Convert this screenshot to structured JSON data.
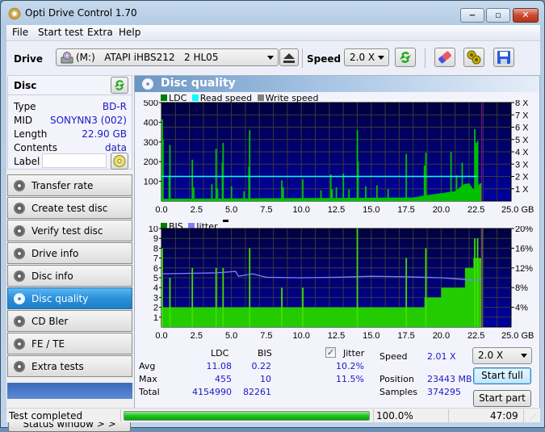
{
  "window": {
    "title": "Opti Drive Control 1.70",
    "controls": {
      "minimize": "‒",
      "maximize": "▫",
      "close": "✕"
    }
  },
  "menu": [
    "File",
    "Start test",
    "Extra",
    "Help"
  ],
  "toolbar": {
    "drive_label": "Drive",
    "drive_value": "(M:)   ATAPI iHBS212   2 HL05",
    "speed_label": "Speed",
    "speed_value": "2.0 X",
    "icons": [
      "eject-icon",
      "refresh-icon",
      "erase-icon",
      "settings-icon",
      "save-icon"
    ]
  },
  "disc": {
    "header": "Disc",
    "rows": [
      {
        "key": "Type",
        "value": "BD-R"
      },
      {
        "key": "MID",
        "value": "SONYNN3 (002)"
      },
      {
        "key": "Length",
        "value": "22.90 GB"
      },
      {
        "key": "Contents",
        "value": "data"
      }
    ],
    "label_key": "Label",
    "label_value": ""
  },
  "nav": [
    {
      "label": "Transfer rate",
      "active": false
    },
    {
      "label": "Create test disc",
      "active": false
    },
    {
      "label": "Verify test disc",
      "active": false
    },
    {
      "label": "Drive info",
      "active": false
    },
    {
      "label": "Disc info",
      "active": false
    },
    {
      "label": "Disc quality",
      "active": true
    },
    {
      "label": "CD Bler",
      "active": false
    },
    {
      "label": "FE / TE",
      "active": false
    },
    {
      "label": "Extra tests",
      "active": false
    }
  ],
  "status_window_button": "Status window > >",
  "panel": {
    "title": "Disc quality",
    "colors": {
      "ldc": "#00c000",
      "read_speed": "#00ffff",
      "write_speed": "#808080",
      "bis": "#00c000",
      "jitter": "#8080ff",
      "plot_bg_top": "#000040",
      "plot_bg_bottom": "#0000a0",
      "grid": "#3a3a3a",
      "marker": "#a000a0"
    }
  },
  "chart_data": [
    {
      "type": "bar",
      "title": "LDC",
      "legend": [
        "LDC",
        "Read speed",
        "Write speed"
      ],
      "legend_position": "top-left",
      "xlabel": "GB",
      "xlim": [
        0,
        25
      ],
      "x_ticks": [
        "0.0",
        "2.5",
        "5.0",
        "7.5",
        "10.0",
        "12.5",
        "15.0",
        "17.5",
        "20.0",
        "22.5",
        "25.0 GB"
      ],
      "y_left_ticks": [
        "100",
        "200",
        "300",
        "400",
        "500"
      ],
      "ylim_left": [
        0,
        500
      ],
      "y_right_ticks": [
        "1 X",
        "2 X",
        "3 X",
        "4 X",
        "5 X",
        "6 X",
        "7 X",
        "8 X"
      ],
      "ylim_right": [
        0,
        8
      ],
      "grid": true,
      "end_marker_gb": 22.9,
      "read_speed_x": 2.0,
      "spikes": [
        {
          "x": 0.05,
          "y": 415
        },
        {
          "x": 0.1,
          "y": 315
        },
        {
          "x": 0.6,
          "y": 285
        },
        {
          "x": 0.55,
          "y": 130
        },
        {
          "x": 2.2,
          "y": 210
        },
        {
          "x": 2.3,
          "y": 70
        },
        {
          "x": 3.6,
          "y": 85
        },
        {
          "x": 3.9,
          "y": 265
        },
        {
          "x": 4.0,
          "y": 65
        },
        {
          "x": 4.4,
          "y": 295
        },
        {
          "x": 4.35,
          "y": 195
        },
        {
          "x": 5.0,
          "y": 75
        },
        {
          "x": 5.9,
          "y": 50
        },
        {
          "x": 6.3,
          "y": 360
        },
        {
          "x": 6.25,
          "y": 175
        },
        {
          "x": 8.6,
          "y": 105
        },
        {
          "x": 8.7,
          "y": 70
        },
        {
          "x": 10.1,
          "y": 110
        },
        {
          "x": 11.4,
          "y": 55
        },
        {
          "x": 12.1,
          "y": 135
        },
        {
          "x": 12.2,
          "y": 60
        },
        {
          "x": 12.5,
          "y": 70
        },
        {
          "x": 13.0,
          "y": 140
        },
        {
          "x": 13.4,
          "y": 60
        },
        {
          "x": 14.0,
          "y": 360
        },
        {
          "x": 14.05,
          "y": 200
        },
        {
          "x": 14.6,
          "y": 75
        },
        {
          "x": 15.4,
          "y": 80
        },
        {
          "x": 16.2,
          "y": 60
        },
        {
          "x": 17.5,
          "y": 240
        },
        {
          "x": 18.9,
          "y": 245
        },
        {
          "x": 18.8,
          "y": 180
        },
        {
          "x": 20.7,
          "y": 250
        },
        {
          "x": 21.1,
          "y": 130
        },
        {
          "x": 21.5,
          "y": 195
        },
        {
          "x": 22.4,
          "y": 365
        },
        {
          "x": 22.5,
          "y": 295
        },
        {
          "x": 22.6,
          "y": 305
        }
      ],
      "baseline_ramp": [
        {
          "x": 0,
          "y": 12
        },
        {
          "x": 18,
          "y": 18
        },
        {
          "x": 19,
          "y": 30
        },
        {
          "x": 20,
          "y": 40
        },
        {
          "x": 21,
          "y": 50
        },
        {
          "x": 21.6,
          "y": 85
        },
        {
          "x": 22.0,
          "y": 90
        },
        {
          "x": 22.3,
          "y": 60
        },
        {
          "x": 22.9,
          "y": 95
        }
      ]
    },
    {
      "type": "bar",
      "title": "BIS",
      "legend": [
        "BIS",
        "Jitter"
      ],
      "legend_position": "top-left",
      "xlabel": "GB",
      "xlim": [
        0,
        25
      ],
      "x_ticks": [
        "0.0",
        "2.5",
        "5.0",
        "7.5",
        "10.0",
        "12.5",
        "15.0",
        "17.5",
        "20.0",
        "22.5",
        "25.0 GB"
      ],
      "y_left_ticks": [
        "1",
        "2",
        "3",
        "4",
        "5",
        "6",
        "7",
        "8",
        "9",
        "10"
      ],
      "ylim_left": [
        0,
        10
      ],
      "y_right_ticks": [
        "4%",
        "8%",
        "12%",
        "16%",
        "20%"
      ],
      "ylim_right": [
        0,
        20
      ],
      "grid": true,
      "end_marker_gb": 22.9,
      "bis_base": [
        {
          "x": 0,
          "y": 2
        },
        {
          "x": 18.8,
          "y": 3
        },
        {
          "x": 20,
          "y": 4
        },
        {
          "x": 21.7,
          "y": 6
        },
        {
          "x": 22.3,
          "y": 7
        },
        {
          "x": 22.9,
          "y": 7
        }
      ],
      "bis_spikes": [
        {
          "x": 0.05,
          "y": 8
        },
        {
          "x": 0.6,
          "y": 5
        },
        {
          "x": 2.2,
          "y": 6
        },
        {
          "x": 3.9,
          "y": 6
        },
        {
          "x": 4.4,
          "y": 6
        },
        {
          "x": 6.3,
          "y": 8
        },
        {
          "x": 8.6,
          "y": 4
        },
        {
          "x": 10.1,
          "y": 4
        },
        {
          "x": 14.0,
          "y": 10
        },
        {
          "x": 17.5,
          "y": 7
        },
        {
          "x": 18.9,
          "y": 8
        },
        {
          "x": 22.4,
          "y": 9
        },
        {
          "x": 22.6,
          "y": 9
        },
        {
          "x": 22.9,
          "y": 10
        }
      ],
      "jitter_percent": [
        {
          "x": 0,
          "y": 10.8
        },
        {
          "x": 2,
          "y": 10.9
        },
        {
          "x": 4,
          "y": 11.0
        },
        {
          "x": 5.3,
          "y": 11.3
        },
        {
          "x": 5.5,
          "y": 10.3
        },
        {
          "x": 6.5,
          "y": 10.8
        },
        {
          "x": 7.5,
          "y": 10.1
        },
        {
          "x": 10,
          "y": 10.0
        },
        {
          "x": 12.5,
          "y": 10.1
        },
        {
          "x": 15,
          "y": 10.3
        },
        {
          "x": 17.5,
          "y": 10.2
        },
        {
          "x": 20,
          "y": 10.0
        },
        {
          "x": 21.5,
          "y": 9.7
        },
        {
          "x": 22.5,
          "y": 9.4
        },
        {
          "x": 22.9,
          "y": 9.8
        }
      ]
    }
  ],
  "stats": {
    "col_ldc": "LDC",
    "col_bis": "BIS",
    "jitter_label": "Jitter",
    "jitter_checked": true,
    "rows": [
      {
        "label": "Avg",
        "ldc": "11.08",
        "bis": "0.22",
        "jitter": "10.2%"
      },
      {
        "label": "Max",
        "ldc": "455",
        "bis": "10",
        "jitter": "11.5%"
      },
      {
        "label": "Total",
        "ldc": "4154990",
        "bis": "82261",
        "jitter": ""
      }
    ],
    "speed_label": "Speed",
    "speed_value": "2.01 X",
    "position_label": "Position",
    "position_value": "23443 MB",
    "samples_label": "Samples",
    "samples_value": "374295",
    "speed_select": "2.0 X",
    "start_full": "Start full",
    "start_part": "Start part"
  },
  "statusbar": {
    "message": "Test completed",
    "progress": 100.0,
    "progress_text": "100.0%",
    "elapsed": "47:09"
  }
}
